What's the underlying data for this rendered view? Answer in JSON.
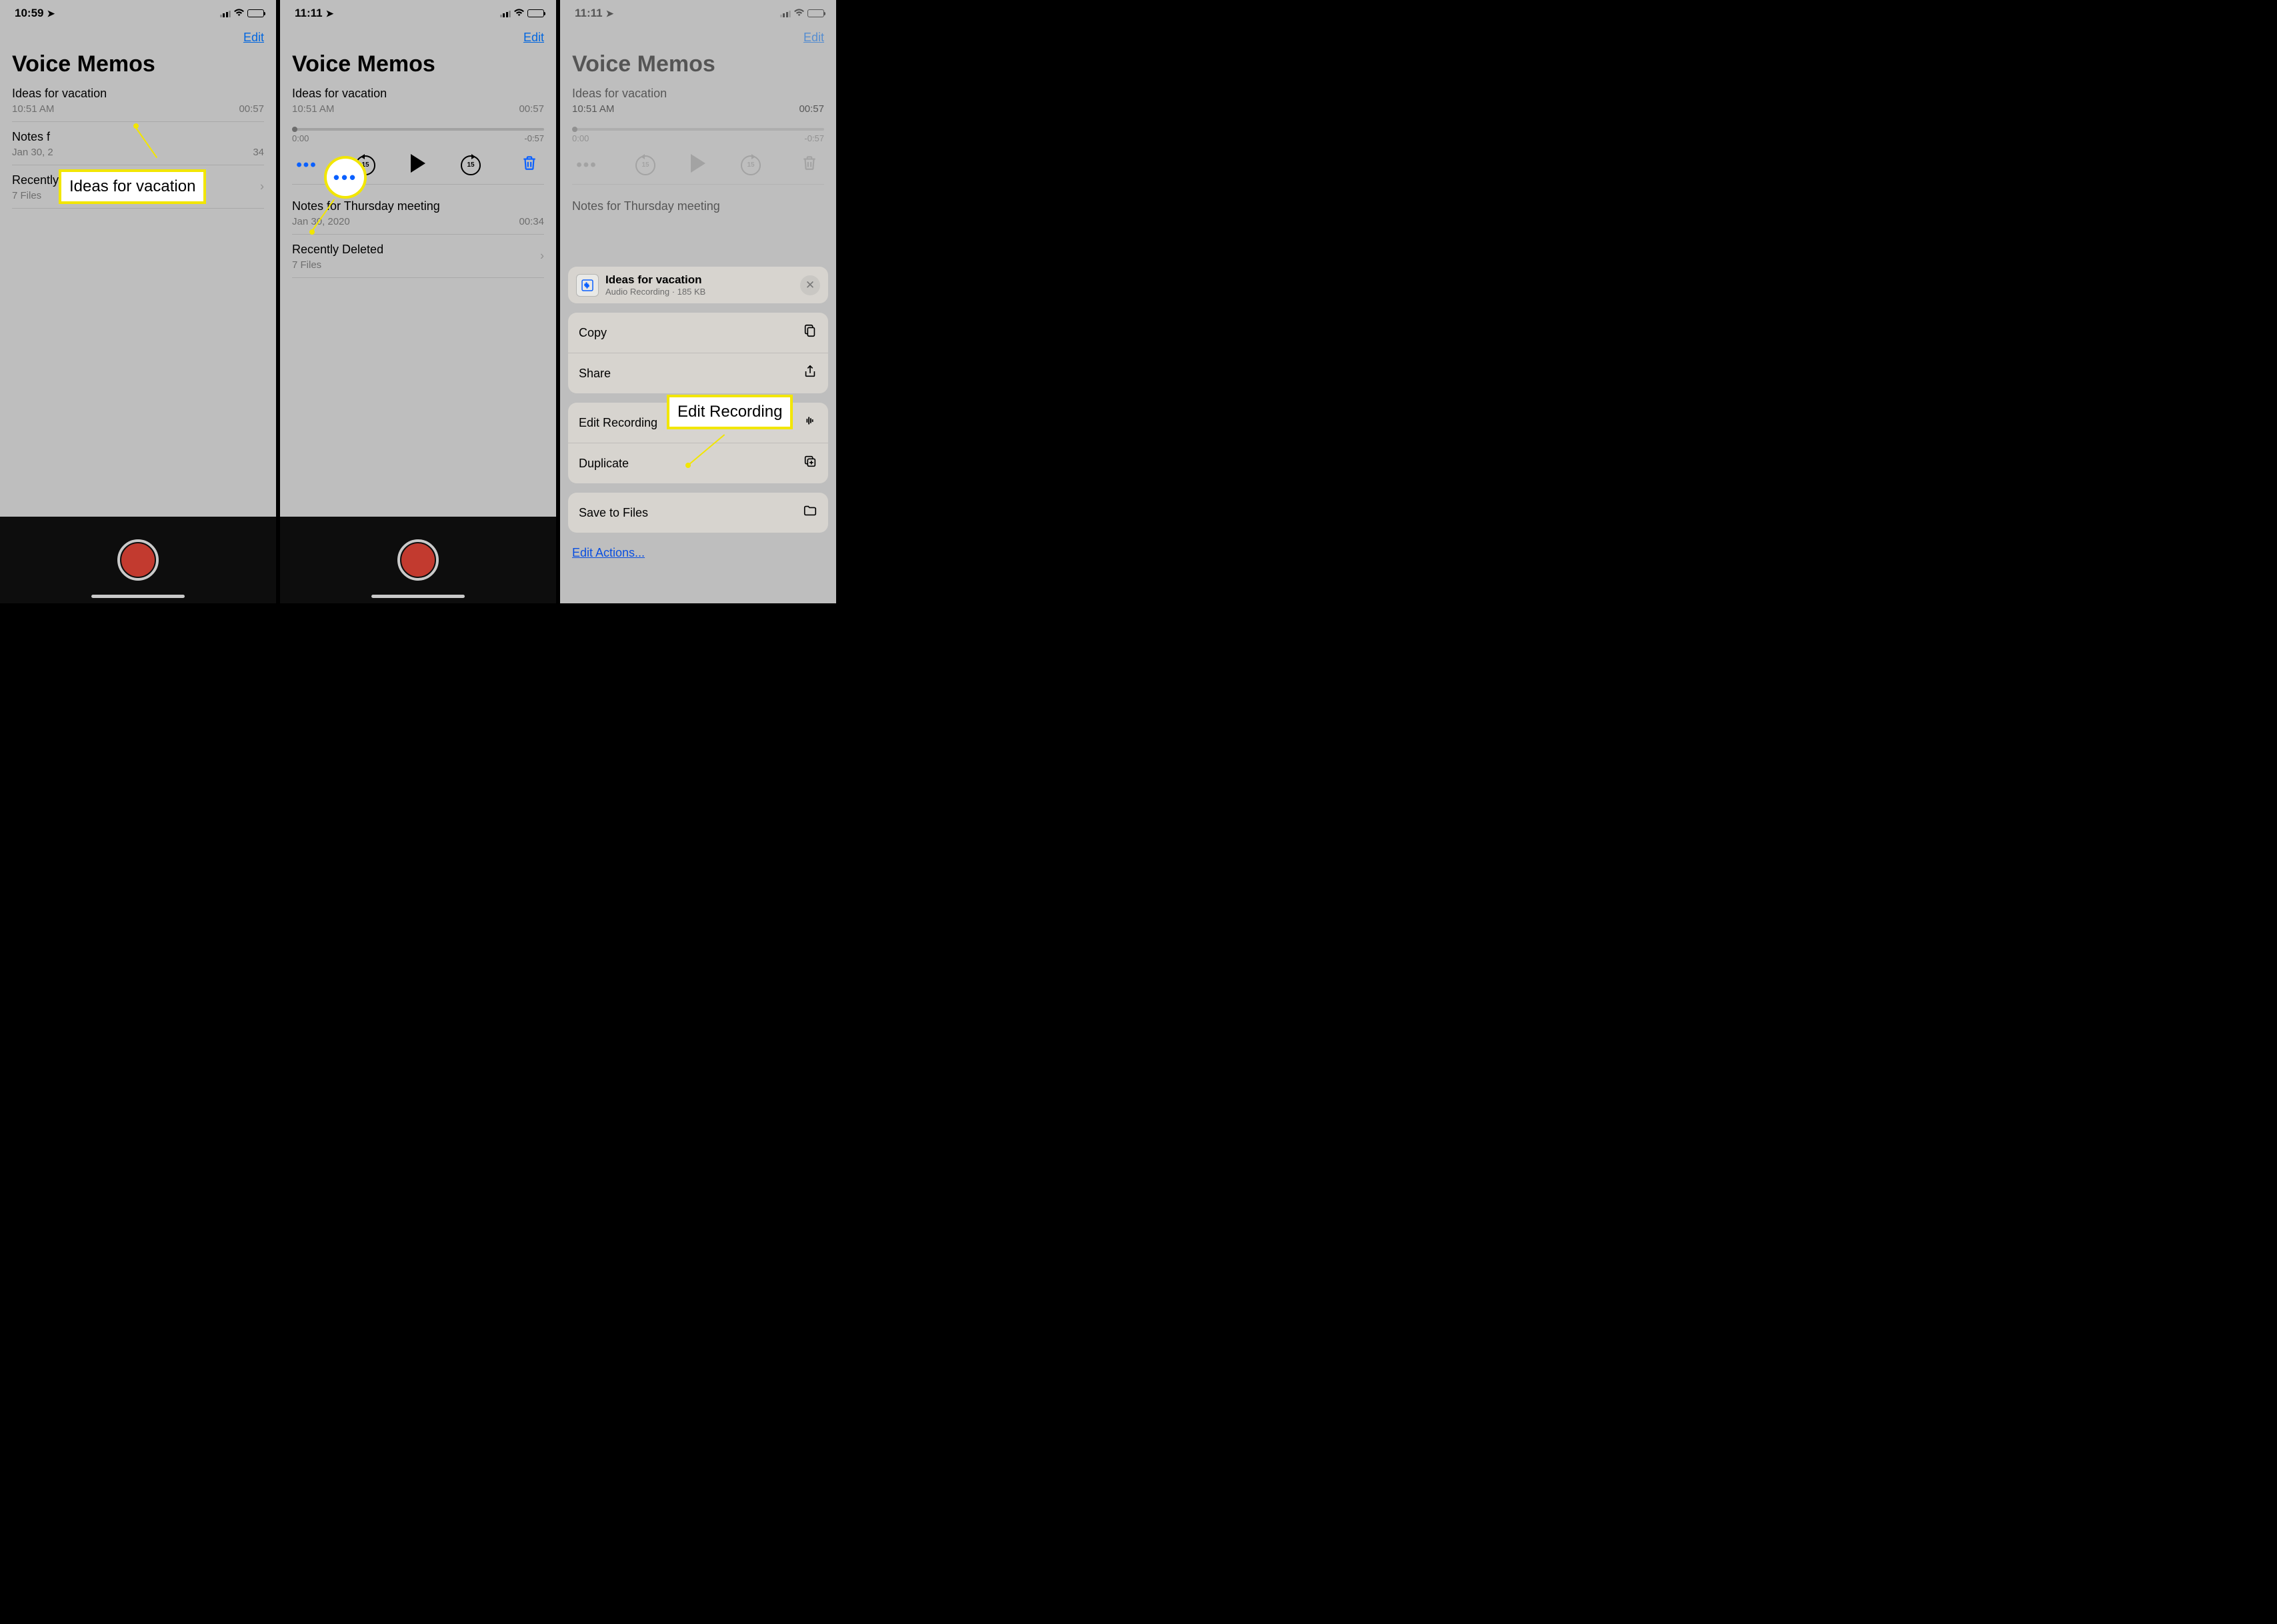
{
  "status": {
    "time_a": "10:59",
    "time_b": "11:11",
    "time_c": "11:11"
  },
  "nav": {
    "edit": "Edit"
  },
  "title": "Voice Memos",
  "memos": {
    "m1": {
      "title": "Ideas for vacation",
      "time": "10:51 AM",
      "dur": "00:57"
    },
    "m2": {
      "title": "Notes for Thursday meeting",
      "date_short": "Jan 30, 2",
      "date": "Jan 30, 2020",
      "dur_short": "34",
      "dur": "00:34"
    }
  },
  "deleted": {
    "title": "Recently Deleted",
    "count": "7 Files"
  },
  "player": {
    "pos": "0:00",
    "remain": "-0:57",
    "skip_sec": "15"
  },
  "callouts": {
    "c1": "Ideas for vacation",
    "c3": "Edit Recording"
  },
  "sheet": {
    "header_title": "Ideas for vacation",
    "header_sub": "Audio Recording · 185 KB",
    "items": {
      "copy": "Copy",
      "share": "Share",
      "edit_rec": "Edit Recording",
      "duplicate": "Duplicate",
      "save_files": "Save to Files"
    },
    "edit_actions": "Edit Actions..."
  }
}
